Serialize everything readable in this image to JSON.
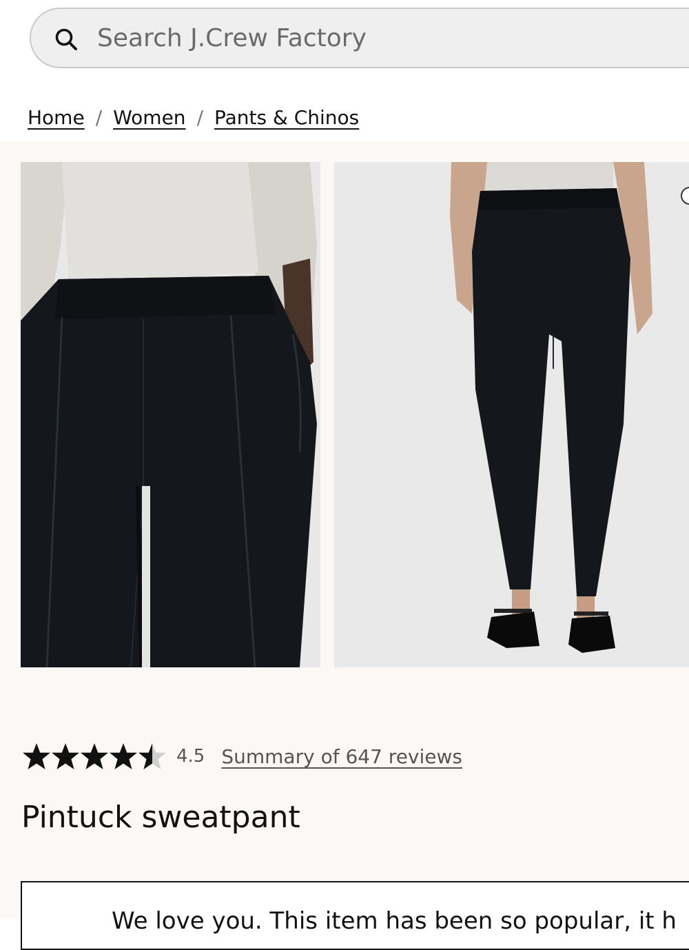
{
  "search": {
    "placeholder": "Search J.Crew Factory"
  },
  "breadcrumb": {
    "items": [
      {
        "label": "Home"
      },
      {
        "label": "Women"
      },
      {
        "label": "Pants & Chinos"
      }
    ],
    "separator": "/"
  },
  "gallery": {
    "images": [
      {
        "alt": "Pintuck sweatpant front close-up"
      },
      {
        "alt": "Pintuck sweatpant back view"
      }
    ]
  },
  "rating": {
    "value": "4.5",
    "stars_out_of": 5,
    "stars_value": 4.5,
    "summary_link": "Summary of 647 reviews"
  },
  "product": {
    "title": "Pintuck sweatpant"
  },
  "notice": {
    "text": "We love you. This item has been so popular, it h"
  },
  "colors": {
    "section_background": "#fbf8f5",
    "search_background": "#efefef",
    "text": "#111111",
    "muted_text": "#555555",
    "pants": "#14171c"
  }
}
